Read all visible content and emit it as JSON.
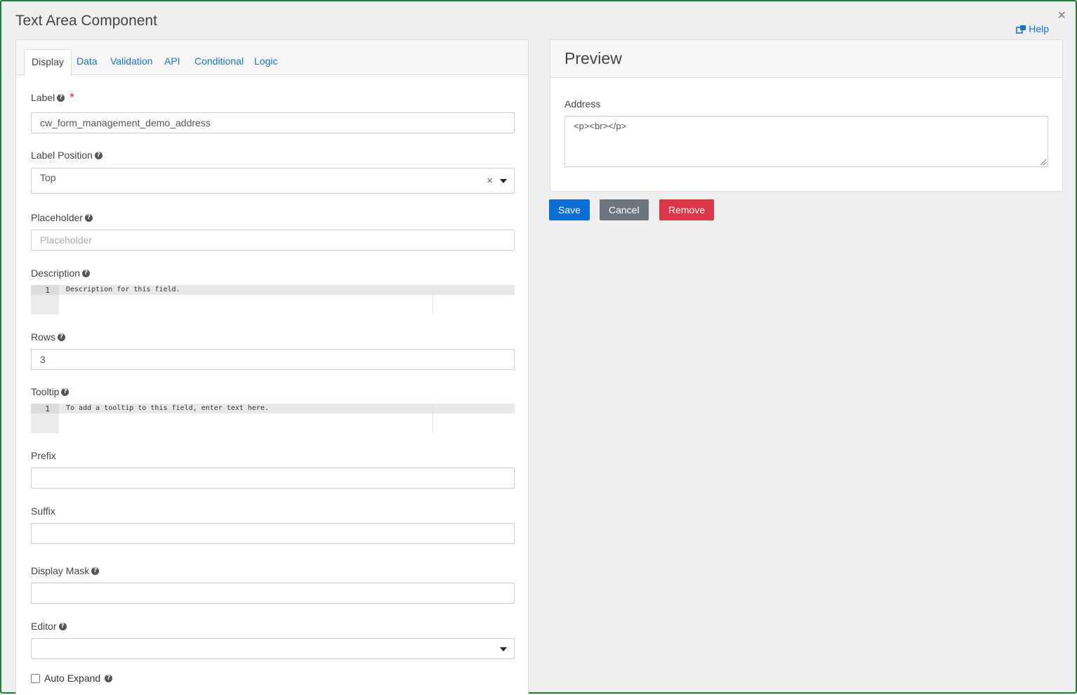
{
  "modal": {
    "title": "Text Area Component",
    "help_label": "Help",
    "close_glyph": "×"
  },
  "tabs": [
    {
      "label": "Display",
      "active": true
    },
    {
      "label": "Data",
      "active": false
    },
    {
      "label": "Validation",
      "active": false
    },
    {
      "label": "API",
      "active": false
    },
    {
      "label": "Conditional",
      "active": false
    },
    {
      "label": "Logic",
      "active": false
    }
  ],
  "fields": {
    "label": {
      "label": "Label",
      "value": "cw_form_management_demo_address",
      "required_glyph": "*"
    },
    "label_position": {
      "label": "Label Position",
      "value": "Top",
      "clear_glyph": "×"
    },
    "placeholder": {
      "label": "Placeholder",
      "placeholder": "Placeholder"
    },
    "description": {
      "label": "Description",
      "line_number": "1",
      "editor_text": "Description for this field."
    },
    "rows": {
      "label": "Rows",
      "value": "3"
    },
    "tooltip": {
      "label": "Tooltip",
      "line_number": "1",
      "editor_text": "To add a tooltip to this field, enter text here."
    },
    "prefix": {
      "label": "Prefix",
      "value": ""
    },
    "suffix": {
      "label": "Suffix",
      "value": ""
    },
    "display_mask": {
      "label": "Display Mask",
      "value": ""
    },
    "editor": {
      "label": "Editor",
      "value": ""
    },
    "auto_expand": {
      "label": "Auto Expand",
      "checked": false
    }
  },
  "help_icon_glyph": "?",
  "preview": {
    "title": "Preview",
    "field_label": "Address",
    "field_value": "<p><br></p>"
  },
  "buttons": {
    "save": "Save",
    "cancel": "Cancel",
    "remove": "Remove"
  },
  "colors": {
    "frame_border": "#1e7e34",
    "link": "#1a73c9",
    "save_bg": "#0b6fd6",
    "cancel_bg": "#6c757d",
    "remove_bg": "#dc3545",
    "required": "#d9202e"
  }
}
